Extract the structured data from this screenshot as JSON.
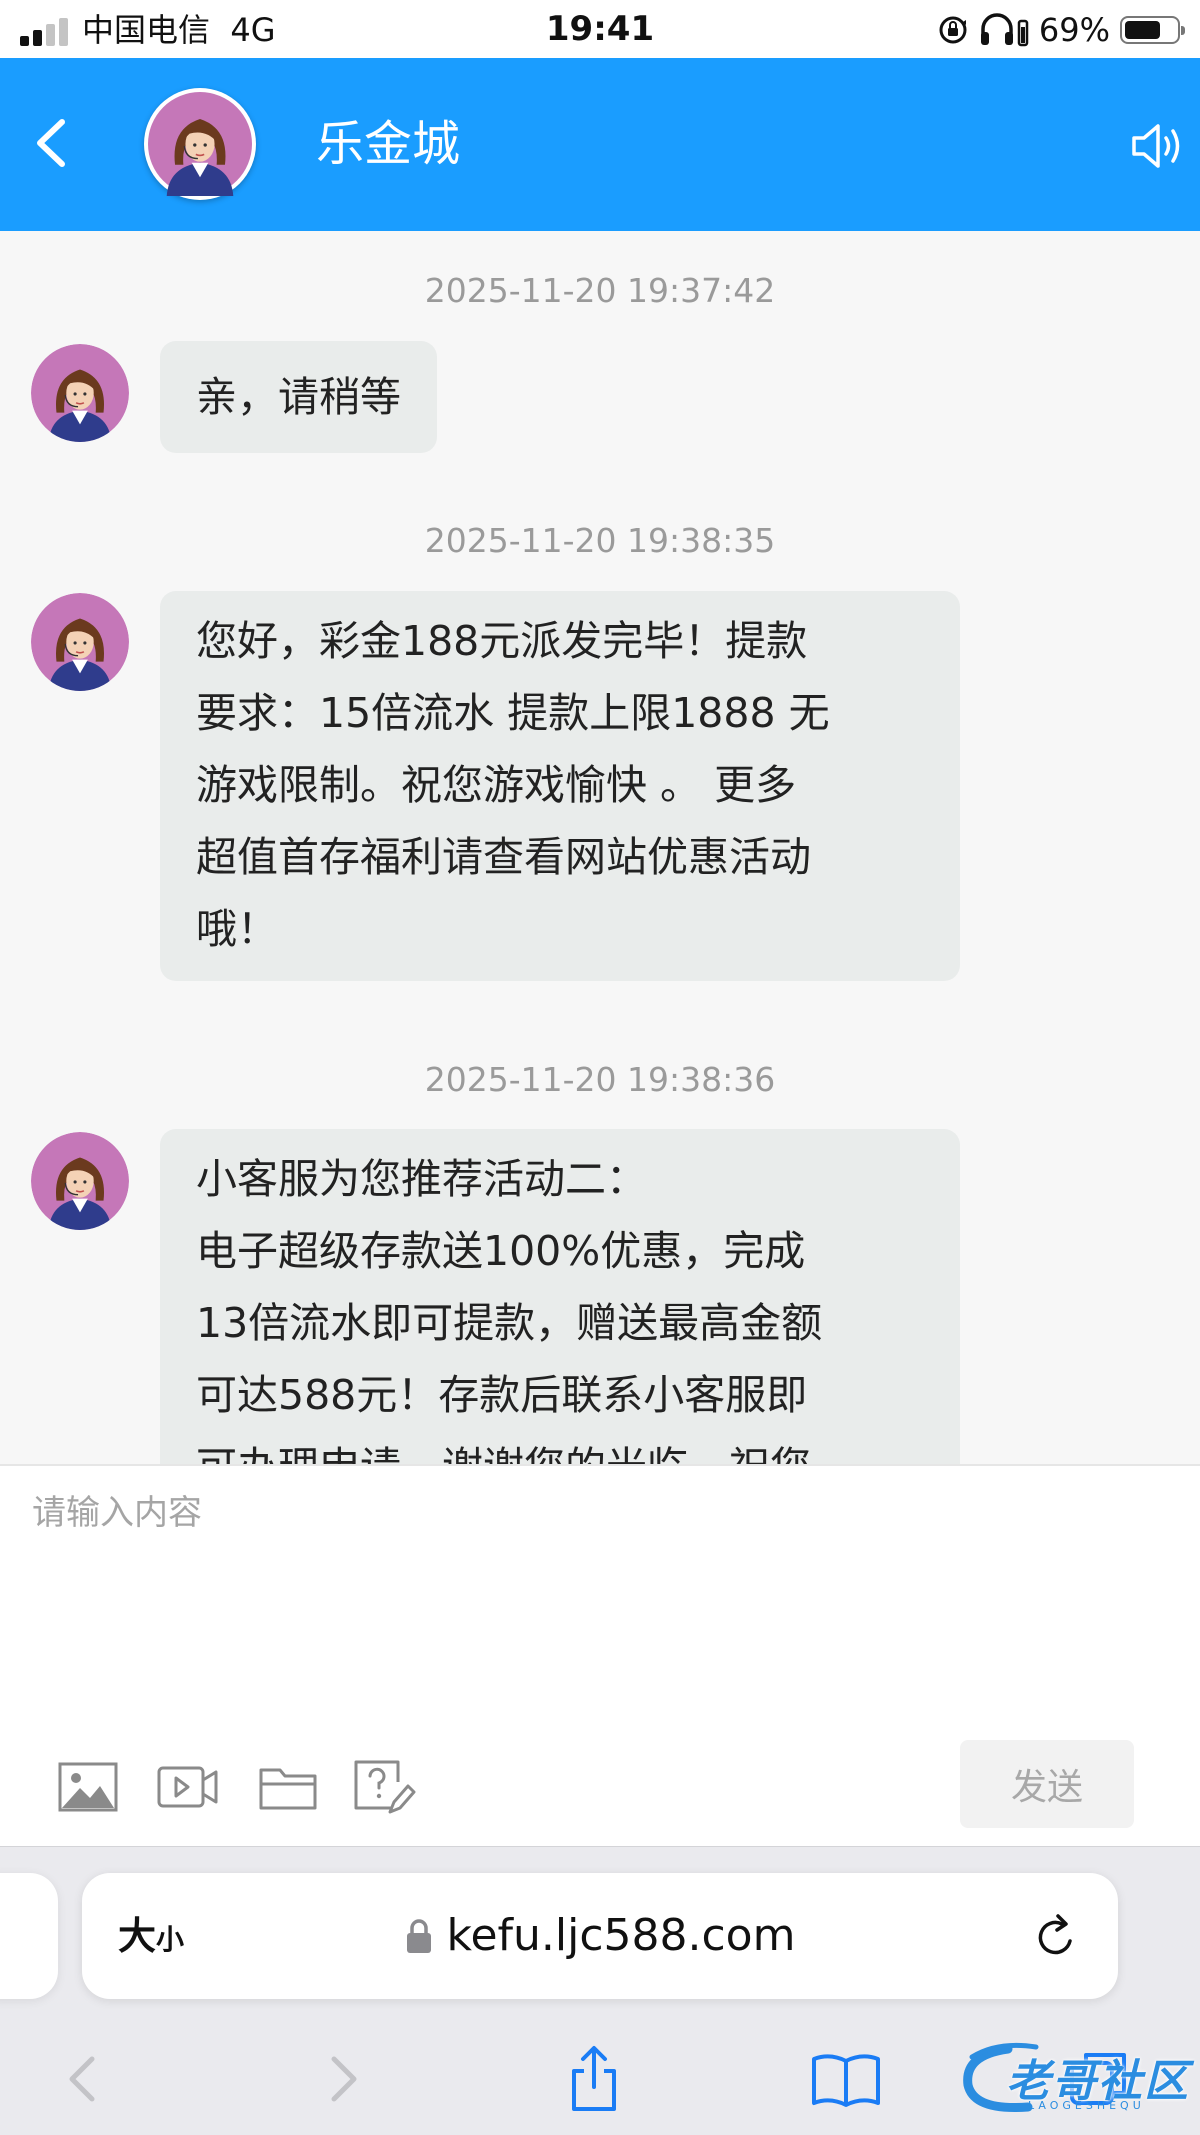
{
  "status_bar": {
    "carrier": "中国电信",
    "network": "4G",
    "time": "19:41",
    "battery_percent": "69%",
    "battery_level": 0.69
  },
  "header": {
    "title": "乐金城",
    "accent_color": "#1a9dff",
    "icons": [
      "chevron-left-icon",
      "agent-avatar",
      "speaker-icon"
    ]
  },
  "messages": [
    {
      "time": "2025-11-20 19:37:42",
      "text": "亲，请稍等"
    },
    {
      "time": "2025-11-20 19:38:35",
      "text": "您好，彩金188元派发完毕！提款\n要求：15倍流水 提款上限1888 无\n游戏限制。祝您游戏愉快 。 更多\n超值首存福利请查看网站优惠活动\n哦！"
    },
    {
      "time": "2025-11-20 19:38:36",
      "text": "小客服为您推荐活动二：\n电子超级存款送100%优惠，完成\n13倍流水即可提款，赠送最高金额\n可达588元！存款后联系小客服即\n可办理申请，谢谢您的光临，祝您"
    }
  ],
  "composer": {
    "placeholder": "请输入内容",
    "value": "",
    "send_label": "发送",
    "tools": [
      "image-icon",
      "video-icon",
      "folder-icon",
      "faq-icon"
    ]
  },
  "browser": {
    "text_size_big": "大",
    "text_size_small": "小",
    "url": "kefu.ljc588.com",
    "nav_icons": [
      "back-icon",
      "forward-icon",
      "share-icon",
      "bookmarks-icon",
      "tabs-icon"
    ],
    "watermark_text": "老哥社区",
    "watermark_subtext": "LAOGESHEQU"
  }
}
